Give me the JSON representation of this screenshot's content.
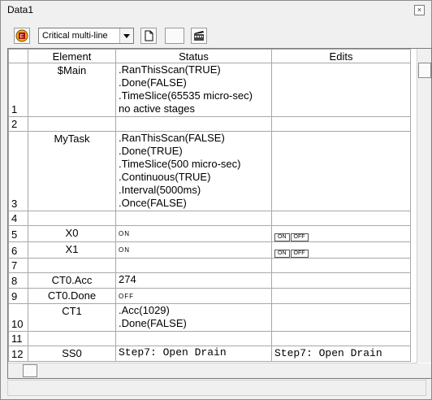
{
  "window": {
    "title": "Data1"
  },
  "toolbar": {
    "mode_select": "Critical multi-line",
    "icons": [
      "stop-icon",
      "new-page-icon",
      "blank-icon",
      "film-clapper-icon"
    ]
  },
  "table": {
    "headers": {
      "element": "Element",
      "status": "Status",
      "edits": "Edits"
    },
    "rows": [
      {
        "num": "1",
        "element": "$Main",
        "status": [
          ".RanThisScan(TRUE)",
          ".Done(FALSE)",
          ".TimeSlice(65535 micro-sec)",
          "no active stages"
        ],
        "edits": ""
      },
      {
        "num": "2",
        "element": "",
        "status": [],
        "edits": ""
      },
      {
        "num": "3",
        "element": "MyTask",
        "status": [
          ".RanThisScan(FALSE)",
          ".Done(TRUE)",
          ".TimeSlice(500 micro-sec)",
          ".Continuous(TRUE)",
          ".Interval(5000ms)",
          ".Once(FALSE)"
        ],
        "edits": ""
      },
      {
        "num": "4",
        "element": "",
        "status": [],
        "edits": ""
      },
      {
        "num": "5",
        "element": "X0",
        "status": [
          "ON"
        ],
        "edits": "ON|OFF"
      },
      {
        "num": "6",
        "element": "X1",
        "status": [
          "ON"
        ],
        "edits": "ON|OFF"
      },
      {
        "num": "7",
        "element": "",
        "status": [],
        "edits": ""
      },
      {
        "num": "8",
        "element": "CT0.Acc",
        "status": [
          "274"
        ],
        "edits": ""
      },
      {
        "num": "9",
        "element": "CT0.Done",
        "status": [
          "OFF"
        ],
        "edits": ""
      },
      {
        "num": "10",
        "element": "CT1",
        "status": [
          ".Acc(1029)",
          ".Done(FALSE)"
        ],
        "edits": ""
      },
      {
        "num": "11",
        "element": "",
        "status": [],
        "edits": ""
      },
      {
        "num": "12",
        "element": "SS0",
        "status": [
          "Step7: Open Drain"
        ],
        "edits": "Step7: Open Drain"
      }
    ],
    "onoff": {
      "on": "ON",
      "off": "OFF"
    }
  }
}
